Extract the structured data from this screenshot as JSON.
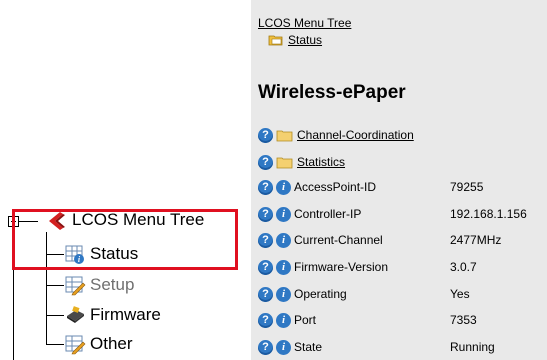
{
  "tree": {
    "root": "LCOS Menu Tree",
    "items": [
      {
        "label": "Status",
        "dim": false
      },
      {
        "label": "Setup",
        "dim": true
      },
      {
        "label": "Firmware",
        "dim": false
      },
      {
        "label": "Other",
        "dim": false
      }
    ]
  },
  "panel": {
    "breadcrumb_root": "LCOS Menu Tree",
    "breadcrumb_current": "Status",
    "title": "Wireless-ePaper",
    "folders": [
      "Channel-Coordination",
      "Statistics"
    ],
    "values": [
      {
        "name": "AccessPoint-ID",
        "value": "79255"
      },
      {
        "name": "Controller-IP",
        "value": "192.168.1.156"
      },
      {
        "name": "Current-Channel",
        "value": "2477MHz"
      },
      {
        "name": "Firmware-Version",
        "value": "3.0.7"
      },
      {
        "name": "Operating",
        "value": "Yes"
      },
      {
        "name": "Port",
        "value": "7353"
      },
      {
        "name": "State",
        "value": "Running"
      }
    ]
  },
  "icons": {
    "help": "?",
    "info": "i"
  },
  "colors": {
    "highlight": "#e01020",
    "panel_bg": "#e9e9e9",
    "info_blue": "#2f78c4"
  }
}
